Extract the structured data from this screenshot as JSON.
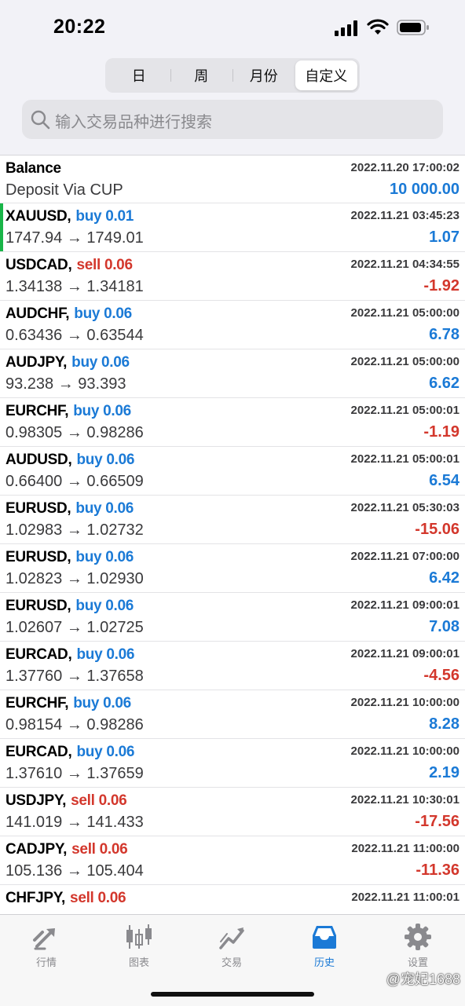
{
  "status": {
    "time": "20:22"
  },
  "filter_tabs": [
    {
      "label": "日",
      "active": false
    },
    {
      "label": "周",
      "active": false
    },
    {
      "label": "月份",
      "active": false
    },
    {
      "label": "自定义",
      "active": true
    }
  ],
  "search": {
    "placeholder": "输入交易品种进行搜索"
  },
  "balance": {
    "title": "Balance",
    "datetime": "2022.11.20 17:00:02",
    "description": "Deposit Via CUP",
    "amount": "10 000.00"
  },
  "trades": [
    {
      "symbol": "XAUUSD,",
      "action": "buy 0.01",
      "side": "buy",
      "datetime": "2022.11.21 03:45:23",
      "prices": "1747.94 → 1749.01",
      "profit": "1.07",
      "highlighted": true
    },
    {
      "symbol": "USDCAD,",
      "action": "sell 0.06",
      "side": "sell",
      "datetime": "2022.11.21 04:34:55",
      "prices": "1.34138 → 1.34181",
      "profit": "-1.92"
    },
    {
      "symbol": "AUDCHF,",
      "action": "buy 0.06",
      "side": "buy",
      "datetime": "2022.11.21 05:00:00",
      "prices": "0.63436 → 0.63544",
      "profit": "6.78"
    },
    {
      "symbol": "AUDJPY,",
      "action": "buy 0.06",
      "side": "buy",
      "datetime": "2022.11.21 05:00:00",
      "prices": "93.238 → 93.393",
      "profit": "6.62"
    },
    {
      "symbol": "EURCHF,",
      "action": "buy 0.06",
      "side": "buy",
      "datetime": "2022.11.21 05:00:01",
      "prices": "0.98305 → 0.98286",
      "profit": "-1.19"
    },
    {
      "symbol": "AUDUSD,",
      "action": "buy 0.06",
      "side": "buy",
      "datetime": "2022.11.21 05:00:01",
      "prices": "0.66400 → 0.66509",
      "profit": "6.54"
    },
    {
      "symbol": "EURUSD,",
      "action": "buy 0.06",
      "side": "buy",
      "datetime": "2022.11.21 05:30:03",
      "prices": "1.02983 → 1.02732",
      "profit": "-15.06"
    },
    {
      "symbol": "EURUSD,",
      "action": "buy 0.06",
      "side": "buy",
      "datetime": "2022.11.21 07:00:00",
      "prices": "1.02823 → 1.02930",
      "profit": "6.42"
    },
    {
      "symbol": "EURUSD,",
      "action": "buy 0.06",
      "side": "buy",
      "datetime": "2022.11.21 09:00:01",
      "prices": "1.02607 → 1.02725",
      "profit": "7.08"
    },
    {
      "symbol": "EURCAD,",
      "action": "buy 0.06",
      "side": "buy",
      "datetime": "2022.11.21 09:00:01",
      "prices": "1.37760 → 1.37658",
      "profit": "-4.56"
    },
    {
      "symbol": "EURCHF,",
      "action": "buy 0.06",
      "side": "buy",
      "datetime": "2022.11.21 10:00:00",
      "prices": "0.98154 → 0.98286",
      "profit": "8.28"
    },
    {
      "symbol": "EURCAD,",
      "action": "buy 0.06",
      "side": "buy",
      "datetime": "2022.11.21 10:00:00",
      "prices": "1.37610 → 1.37659",
      "profit": "2.19"
    },
    {
      "symbol": "USDJPY,",
      "action": "sell 0.06",
      "side": "sell",
      "datetime": "2022.11.21 10:30:01",
      "prices": "141.019 → 141.433",
      "profit": "-17.56"
    },
    {
      "symbol": "CADJPY,",
      "action": "sell 0.06",
      "side": "sell",
      "datetime": "2022.11.21 11:00:00",
      "prices": "105.136 → 105.404",
      "profit": "-11.36"
    },
    {
      "symbol": "CHFJPY,",
      "action": "sell 0.06",
      "side": "sell",
      "datetime": "2022.11.21 11:00:01",
      "prices": "",
      "profit": ""
    }
  ],
  "tabbar": [
    {
      "label": "行情",
      "icon": "quotes-arrows-icon",
      "active": false
    },
    {
      "label": "图表",
      "icon": "candlestick-chart-icon",
      "active": false
    },
    {
      "label": "交易",
      "icon": "trade-trend-icon",
      "active": false
    },
    {
      "label": "历史",
      "icon": "history-inbox-icon",
      "active": true
    },
    {
      "label": "设置",
      "icon": "gear-icon",
      "active": false
    }
  ],
  "watermark": "@宠妃1688",
  "colors": {
    "buy": "#1b7ad6",
    "sell": "#d3372c",
    "active_marker": "#19b548"
  }
}
